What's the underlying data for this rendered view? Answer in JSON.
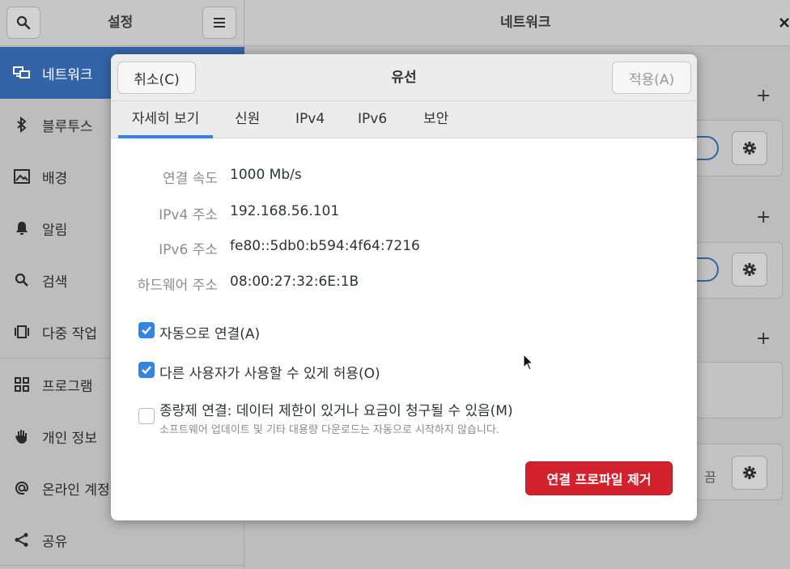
{
  "settings_header": {
    "title": "설정"
  },
  "panel_header": {
    "title": "네트워크"
  },
  "sidebar": {
    "items": [
      {
        "label": "네트워크",
        "icon": "network-icon"
      },
      {
        "label": "블루투스",
        "icon": "bluetooth-icon"
      },
      {
        "label": "배경",
        "icon": "background-icon"
      },
      {
        "label": "알림",
        "icon": "bell-icon"
      },
      {
        "label": "검색",
        "icon": "search-icon"
      },
      {
        "label": "다중 작업",
        "icon": "multitasking-icon"
      },
      {
        "label": "프로그램",
        "icon": "apps-icon"
      },
      {
        "label": "개인 정보",
        "icon": "hand-icon"
      },
      {
        "label": "온라인 계정",
        "icon": "at-icon"
      },
      {
        "label": "공유",
        "icon": "share-icon"
      }
    ]
  },
  "right_pane": {
    "vpn_status": "끔"
  },
  "dialog": {
    "title": "유선",
    "cancel_label": "취소(C)",
    "apply_label": "적용(A)",
    "tabs": [
      {
        "label": "자세히 보기"
      },
      {
        "label": "신원"
      },
      {
        "label": "IPv4"
      },
      {
        "label": "IPv6"
      },
      {
        "label": "보안"
      }
    ],
    "details": [
      {
        "label": "연결 속도",
        "value": "1000 Mb/s"
      },
      {
        "label": "IPv4 주소",
        "value": "192.168.56.101"
      },
      {
        "label": "IPv6 주소",
        "value": "fe80::5db0:b594:4f64:7216"
      },
      {
        "label": "하드웨어 주소",
        "value": "08:00:27:32:6E:1B"
      }
    ],
    "options": [
      {
        "label": "자동으로 연결(A)",
        "checked": true
      },
      {
        "label": "다른 사용자가 사용할 수 있게 허용(O)",
        "checked": true
      },
      {
        "label": "종량제 연결: 데이터 제한이 있거나 요금이 청구될 수 있음(M)",
        "checked": false,
        "sublabel": "소프트웨어 업데이트 및 기타 대용량 다운로드는 자동으로 시작하지 않습니다."
      }
    ],
    "remove_label": "연결 프로파일 제거"
  }
}
